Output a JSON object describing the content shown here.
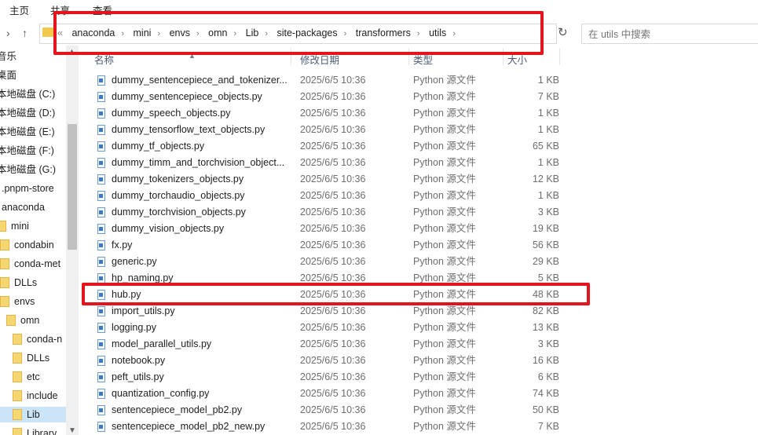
{
  "ribbon": {
    "tabs": [
      "主页",
      "共享",
      "查看"
    ]
  },
  "address": {
    "lead": "«",
    "crumbs": [
      "anaconda",
      "mini",
      "envs",
      "omn",
      "Lib",
      "site-packages",
      "transformers",
      "utils"
    ],
    "search_placeholder": "在 utils 中搜索"
  },
  "sidebar": {
    "items": [
      {
        "label": "音乐"
      },
      {
        "label": "桌面"
      },
      {
        "label": "本地磁盘 (C:)"
      },
      {
        "label": "本地磁盘 (D:)"
      },
      {
        "label": "本地磁盘 (E:)"
      },
      {
        "label": "本地磁盘 (F:)"
      },
      {
        "label": "本地磁盘 (G:)"
      },
      {
        "label": ".pnpm-store"
      },
      {
        "label": "anaconda"
      },
      {
        "label": "mini"
      },
      {
        "label": "condabin"
      },
      {
        "label": "conda-met"
      },
      {
        "label": "DLLs"
      },
      {
        "label": "envs"
      },
      {
        "label": "omn"
      },
      {
        "label": "conda-n"
      },
      {
        "label": "DLLs"
      },
      {
        "label": "etc"
      },
      {
        "label": "include"
      },
      {
        "label": "Lib"
      },
      {
        "label": "Library"
      }
    ]
  },
  "columns": {
    "name": "名称",
    "date": "修改日期",
    "type": "类型",
    "size": "大小"
  },
  "files": [
    {
      "name": "dummy_sentencepiece_and_tokenizer...",
      "date": "2025/6/5 10:36",
      "type": "Python 源文件",
      "size": "1 KB"
    },
    {
      "name": "dummy_sentencepiece_objects.py",
      "date": "2025/6/5 10:36",
      "type": "Python 源文件",
      "size": "7 KB"
    },
    {
      "name": "dummy_speech_objects.py",
      "date": "2025/6/5 10:36",
      "type": "Python 源文件",
      "size": "1 KB"
    },
    {
      "name": "dummy_tensorflow_text_objects.py",
      "date": "2025/6/5 10:36",
      "type": "Python 源文件",
      "size": "1 KB"
    },
    {
      "name": "dummy_tf_objects.py",
      "date": "2025/6/5 10:36",
      "type": "Python 源文件",
      "size": "65 KB"
    },
    {
      "name": "dummy_timm_and_torchvision_object...",
      "date": "2025/6/5 10:36",
      "type": "Python 源文件",
      "size": "1 KB"
    },
    {
      "name": "dummy_tokenizers_objects.py",
      "date": "2025/6/5 10:36",
      "type": "Python 源文件",
      "size": "12 KB"
    },
    {
      "name": "dummy_torchaudio_objects.py",
      "date": "2025/6/5 10:36",
      "type": "Python 源文件",
      "size": "1 KB"
    },
    {
      "name": "dummy_torchvision_objects.py",
      "date": "2025/6/5 10:36",
      "type": "Python 源文件",
      "size": "3 KB"
    },
    {
      "name": "dummy_vision_objects.py",
      "date": "2025/6/5 10:36",
      "type": "Python 源文件",
      "size": "19 KB"
    },
    {
      "name": "fx.py",
      "date": "2025/6/5 10:36",
      "type": "Python 源文件",
      "size": "56 KB"
    },
    {
      "name": "generic.py",
      "date": "2025/6/5 10:36",
      "type": "Python 源文件",
      "size": "29 KB"
    },
    {
      "name": "hp_naming.py",
      "date": "2025/6/5 10:36",
      "type": "Python 源文件",
      "size": "5 KB"
    },
    {
      "name": "hub.py",
      "date": "2025/6/5 10:36",
      "type": "Python 源文件",
      "size": "48 KB"
    },
    {
      "name": "import_utils.py",
      "date": "2025/6/5 10:36",
      "type": "Python 源文件",
      "size": "82 KB"
    },
    {
      "name": "logging.py",
      "date": "2025/6/5 10:36",
      "type": "Python 源文件",
      "size": "13 KB"
    },
    {
      "name": "model_parallel_utils.py",
      "date": "2025/6/5 10:36",
      "type": "Python 源文件",
      "size": "3 KB"
    },
    {
      "name": "notebook.py",
      "date": "2025/6/5 10:36",
      "type": "Python 源文件",
      "size": "16 KB"
    },
    {
      "name": "peft_utils.py",
      "date": "2025/6/5 10:36",
      "type": "Python 源文件",
      "size": "6 KB"
    },
    {
      "name": "quantization_config.py",
      "date": "2025/6/5 10:36",
      "type": "Python 源文件",
      "size": "74 KB"
    },
    {
      "name": "sentencepiece_model_pb2.py",
      "date": "2025/6/5 10:36",
      "type": "Python 源文件",
      "size": "50 KB"
    },
    {
      "name": "sentencepiece_model_pb2_new.py",
      "date": "2025/6/5 10:36",
      "type": "Python 源文件",
      "size": "7 KB"
    }
  ],
  "colors": {
    "highlight": "#e3141b",
    "folder": "#f7d774",
    "selection": "#cce4f7"
  }
}
